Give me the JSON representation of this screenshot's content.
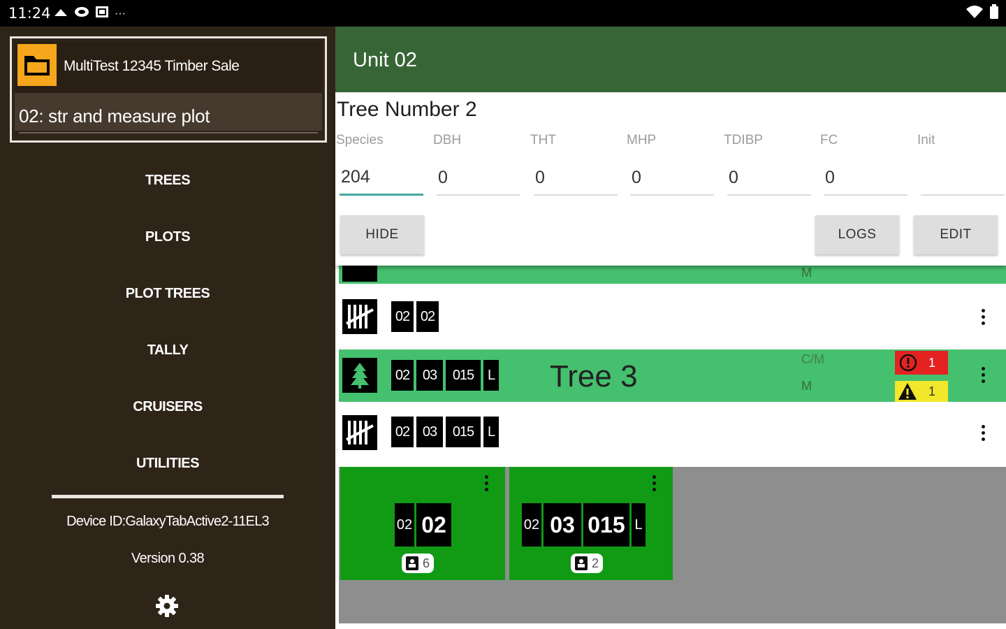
{
  "status_bar": {
    "time": "11:24",
    "more": "···"
  },
  "drawer": {
    "sale_name": "MultiTest 12345 Timber Sale",
    "plot_name": "02: str and measure plot",
    "nav": [
      "TREES",
      "PLOTS",
      "PLOT TREES",
      "TALLY",
      "CRUISERS",
      "UTILITIES"
    ],
    "device_id": "Device ID:GalaxyTabActive2-11EL3",
    "version": "Version 0.38"
  },
  "appbar": {
    "title": "Unit 02"
  },
  "tree_panel": {
    "title": "Tree Number 2",
    "fields": [
      {
        "label": "Species",
        "value": "204"
      },
      {
        "label": "DBH",
        "value": "0"
      },
      {
        "label": "THT",
        "value": "0"
      },
      {
        "label": "MHP",
        "value": "0"
      },
      {
        "label": "TDIBP",
        "value": "0"
      },
      {
        "label": "FC",
        "value": "0"
      },
      {
        "label": "Init",
        "value": ""
      }
    ],
    "buttons": {
      "hide": "HIDE",
      "logs": "LOGS",
      "edit": "EDIT"
    }
  },
  "list": {
    "row_partial": {
      "meta": "M"
    },
    "row_tally_1": {
      "badges": [
        "02",
        "02"
      ]
    },
    "row_tree_3": {
      "badges": [
        "02",
        "03",
        "015",
        "L"
      ],
      "title": "Tree 3",
      "meta_top": "C/M",
      "meta_bottom": "M",
      "error_count": "1",
      "warning_count": "1"
    },
    "row_tally_2": {
      "badges": [
        "02",
        "03",
        "015",
        "L"
      ]
    }
  },
  "cards": [
    {
      "badges": [
        "02",
        "02"
      ],
      "count": "6"
    },
    {
      "badges": [
        "02",
        "03",
        "015",
        "L"
      ],
      "count": "2"
    }
  ],
  "colors": {
    "drawer_bg": "#2f2418",
    "appbar": "#386536",
    "row_green": "#45c06e",
    "card_green": "#119a14",
    "folder": "#f5a61b",
    "error": "#e52222",
    "warning": "#f2e72a",
    "accent_input": "#43a99f"
  }
}
